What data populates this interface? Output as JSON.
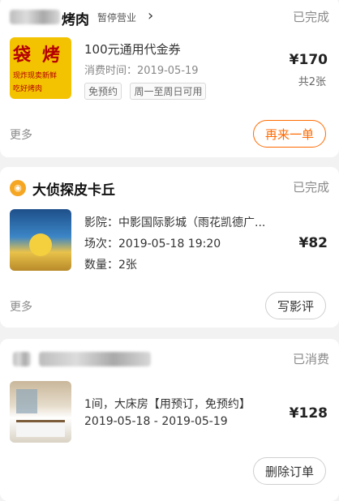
{
  "orders": [
    {
      "shop_name": "烤肉",
      "shop_tag": "暂停营业",
      "status": "已完成",
      "product_title": "100元通用代金券",
      "consume_time": "消费时间：2019-05-19",
      "tags": [
        "免预约",
        "周一至周日可用"
      ],
      "price": "¥170",
      "quantity": "共2张",
      "more_label": "更多",
      "action_label": "再来一单",
      "thumb_text": [
        "袋",
        "烤",
        "现炸现卖新鲜",
        "吃好烤肉"
      ]
    },
    {
      "shop_name": "大侦探皮卡丘",
      "status": "已完成",
      "cinema": "影院：中影国际影城（雨花凯德广...",
      "session": "场次：2019-05-18 19:20",
      "count": "数量：2张",
      "price": "¥82",
      "more_label": "更多",
      "action_label": "写影评"
    },
    {
      "status": "已消费",
      "room": "1间，大床房【用预订，免预约】",
      "dates": "2019-05-18 - 2019-05-19",
      "price": "¥128",
      "action_label": "删除订单"
    }
  ],
  "colors": {
    "accent": "#ff6a00",
    "status_gray": "#8a8a8a",
    "background": "#f2f2f2"
  },
  "icons": {
    "chevron": "chevron-right-icon",
    "movie_badge": "movie-badge-icon"
  }
}
